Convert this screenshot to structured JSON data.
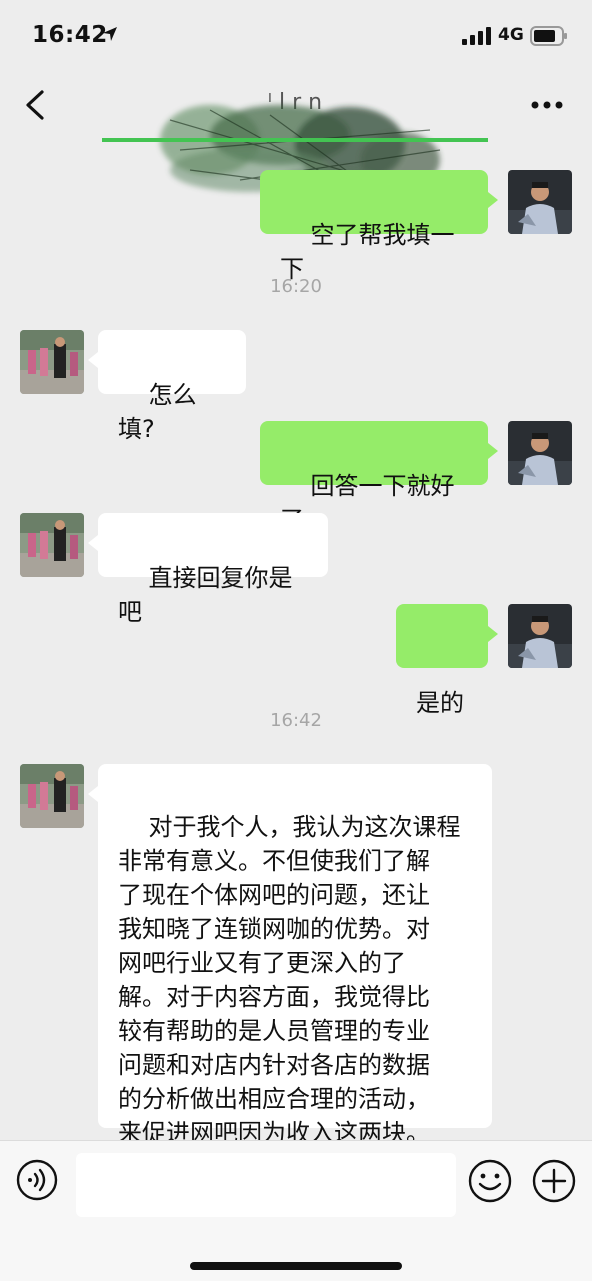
{
  "status_bar": {
    "time": "16:42",
    "network": "4G"
  },
  "nav": {
    "title": "ᴵ l r n"
  },
  "messages": [
    {
      "text": "空了帮我填一下"
    },
    {
      "text": "怎么填?"
    },
    {
      "text": "回答一下就好了"
    },
    {
      "text": "直接回复你是吧"
    },
    {
      "text": "是的"
    },
    {
      "text": "对于我个人，我认为这次课程\n非常有意义。不但使我们了解\n了现在个体网吧的问题，还让\n我知晓了连锁网咖的优势。对\n网吧行业又有了更深入的了\n解。对于内容方面，我觉得比\n较有帮助的是人员管理的专业\n问题和对店内针对各店的数据\n的分析做出相应合理的活动，\n来促进网吧因为收入这两块。"
    }
  ],
  "timestamps": [
    "16:20",
    "16:42"
  ],
  "input_bar": {
    "placeholder": ""
  },
  "colors": {
    "me_bubble": "#95ec69",
    "them_bubble": "#ffffff",
    "background": "#ededed"
  },
  "icons": [
    "back-chevron-icon",
    "more-dots-icon",
    "voice-icon",
    "emoji-icon",
    "plus-icon",
    "location-arrow-icon",
    "signal-icon",
    "battery-icon"
  ]
}
